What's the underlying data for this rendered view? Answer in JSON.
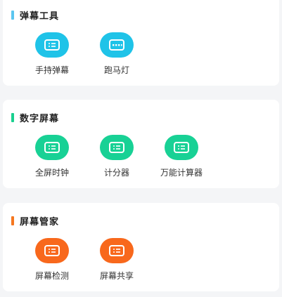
{
  "sections": [
    {
      "title": "弹幕工具",
      "accent_color": "#5bc6f0",
      "icon_color": "#1fc3e8",
      "tools": [
        {
          "label": "手持弹幕",
          "icon": "list-icon"
        },
        {
          "label": "跑马灯",
          "icon": "marquee-icon"
        }
      ]
    },
    {
      "title": "数字屏幕",
      "accent_color": "#19d08f",
      "icon_color": "#18d195",
      "tools": [
        {
          "label": "全屏时钟",
          "icon": "list-icon"
        },
        {
          "label": "计分器",
          "icon": "list-icon"
        },
        {
          "label": "万能计算器",
          "icon": "list-icon"
        }
      ]
    },
    {
      "title": "屏幕管家",
      "accent_color": "#f5771f",
      "icon_color": "#f8681c",
      "tools": [
        {
          "label": "屏幕检测",
          "icon": "list-icon"
        },
        {
          "label": "屏幕共享",
          "icon": "list-icon"
        }
      ]
    }
  ]
}
